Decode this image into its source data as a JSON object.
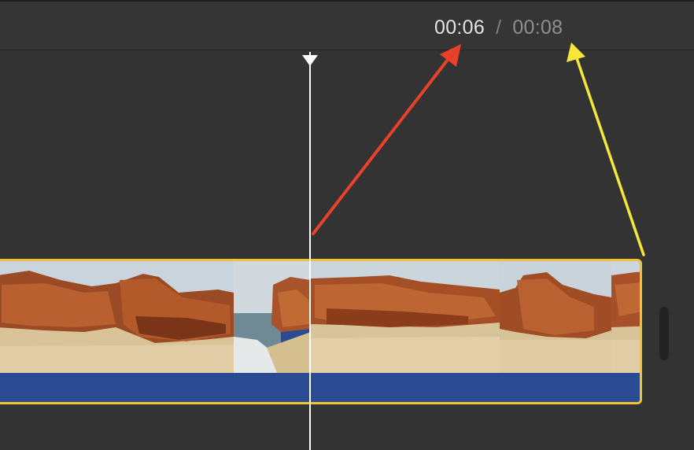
{
  "timecode": {
    "current": "00:06",
    "separator": "/",
    "total": "00:08"
  },
  "colors": {
    "clip_border": "#f2c230",
    "audio_track": "#2a4a92",
    "playhead": "#ffffff",
    "arrow_current": "#e8402a",
    "arrow_total": "#f6e73b"
  },
  "icons": {
    "playhead": "playhead-triangle-icon"
  }
}
